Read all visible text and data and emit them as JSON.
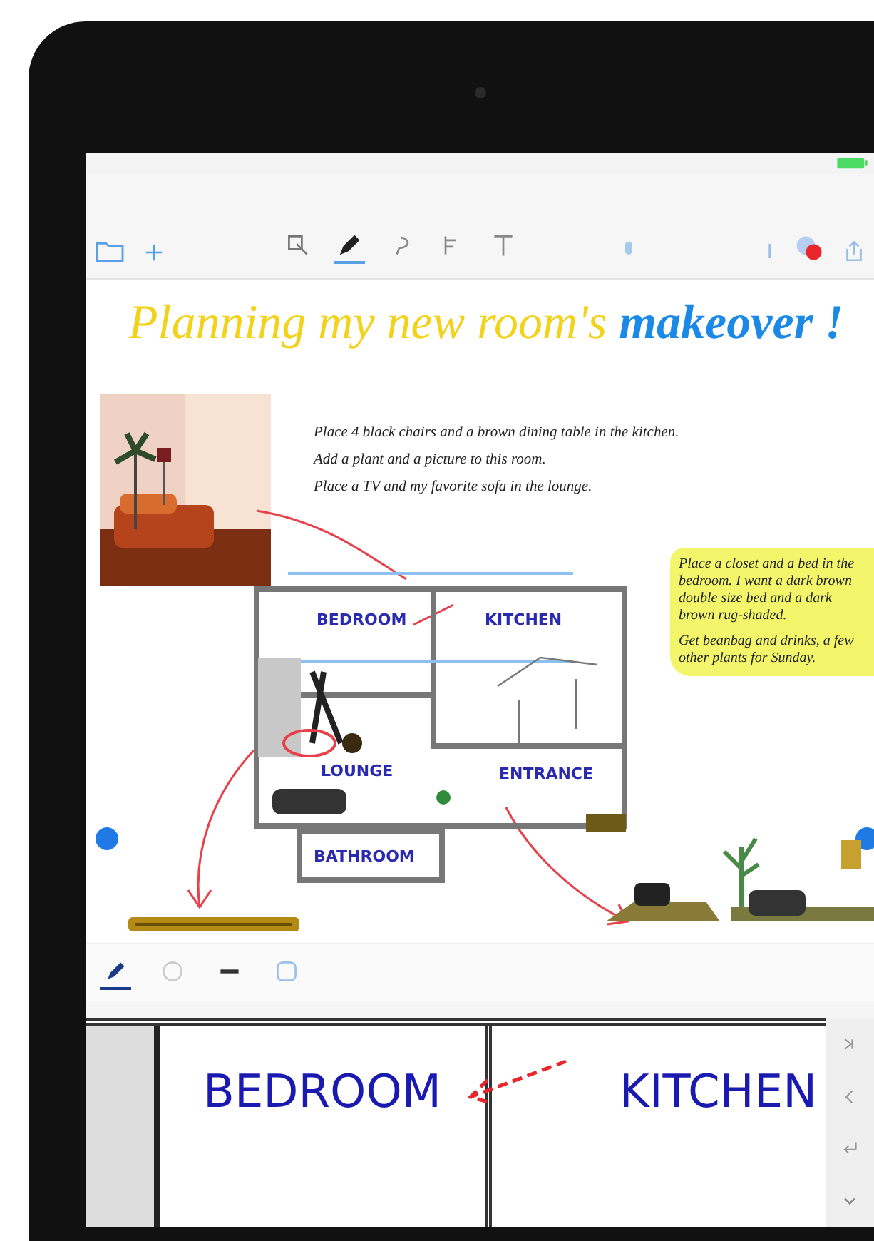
{
  "main_toolbar": {
    "tools": [
      {
        "kind": "select",
        "selected": false
      },
      {
        "kind": "pen",
        "selected": true
      },
      {
        "kind": "lasso",
        "selected": false
      },
      {
        "kind": "shapes",
        "selected": false
      },
      {
        "kind": "text",
        "selected": false
      }
    ]
  },
  "title": {
    "text": "Planning my new room's",
    "accent": "makeover !"
  },
  "notes": [
    "Place 4 black chairs and a brown dining table in the kitchen.",
    "Add a plant and a picture to this room.",
    "Place a TV and my favorite sofa in the lounge."
  ],
  "sticky_note": {
    "lines": [
      "Place a closet and a bed in the bedroom. I want a dark brown double size bed and a dark brown rug-shaded.",
      "Get beanbag and drinks, a few other plants for Sunday."
    ]
  },
  "floor_plan": {
    "rooms": [
      {
        "label": "BEDROOM"
      },
      {
        "label": "KITCHEN"
      },
      {
        "label": "LOUNGE"
      },
      {
        "label": "ENTRANCE"
      },
      {
        "label": "BATHROOM"
      }
    ]
  },
  "pen_toolbar": {
    "tools": [
      {
        "kind": "pen",
        "selected": true
      },
      {
        "kind": "eraser",
        "selected": false
      },
      {
        "kind": "line",
        "selected": false
      },
      {
        "kind": "lasso",
        "selected": false
      }
    ]
  },
  "zoom_window": {
    "labels": [
      "BEDROOM",
      "KITCHEN"
    ]
  }
}
